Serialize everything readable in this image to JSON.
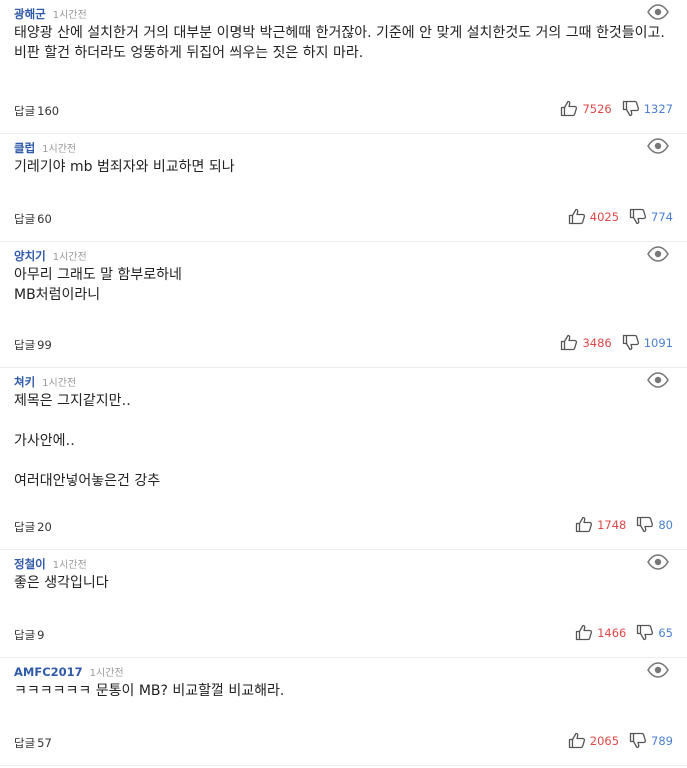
{
  "reply_label": "답글",
  "colors": {
    "author": "#2f5aa8",
    "like": "#e04848",
    "dislike": "#4a7fd1"
  },
  "comments": [
    {
      "author": "광해군",
      "time": "1시간전",
      "lines": [
        "태양광 산에 설치한거 거의 대부분 이명박 박근헤때 한거잖아. 기준에 안 맞게 설치한것도 거의 그때 한것들이고.",
        "비판 할건 하더라도 엉뚱하게 뒤집어 씌우는 짓은 하지 마라."
      ],
      "replies": "160",
      "likes": "7526",
      "dislikes": "1327"
    },
    {
      "author": "클럽",
      "time": "1시간전",
      "lines": [
        "기레기야 mb 범죄자와 비교하면 되나"
      ],
      "replies": "60",
      "likes": "4025",
      "dislikes": "774"
    },
    {
      "author": "양치기",
      "time": "1시간전",
      "lines": [
        "아무리 그래도 말 함부로하네",
        "MB처럼이라니"
      ],
      "replies": "99",
      "likes": "3486",
      "dislikes": "1091"
    },
    {
      "author": "쳐키",
      "time": "1시간전",
      "lines": [
        "제목은 그지같지만‥",
        "",
        "가사안에‥",
        "",
        "여러대안넣어놓은건 강추"
      ],
      "replies": "20",
      "likes": "1748",
      "dislikes": "80"
    },
    {
      "author": "정철이",
      "time": "1시간전",
      "lines": [
        "좋은 생각입니다"
      ],
      "replies": "9",
      "likes": "1466",
      "dislikes": "65"
    },
    {
      "author": "AMFC2017",
      "time": "1시간전",
      "lines": [
        "ㅋㅋㅋㅋㅋㅋ 문통이 MB? 비교할껄 비교해라."
      ],
      "replies": "57",
      "likes": "2065",
      "dislikes": "789"
    }
  ]
}
